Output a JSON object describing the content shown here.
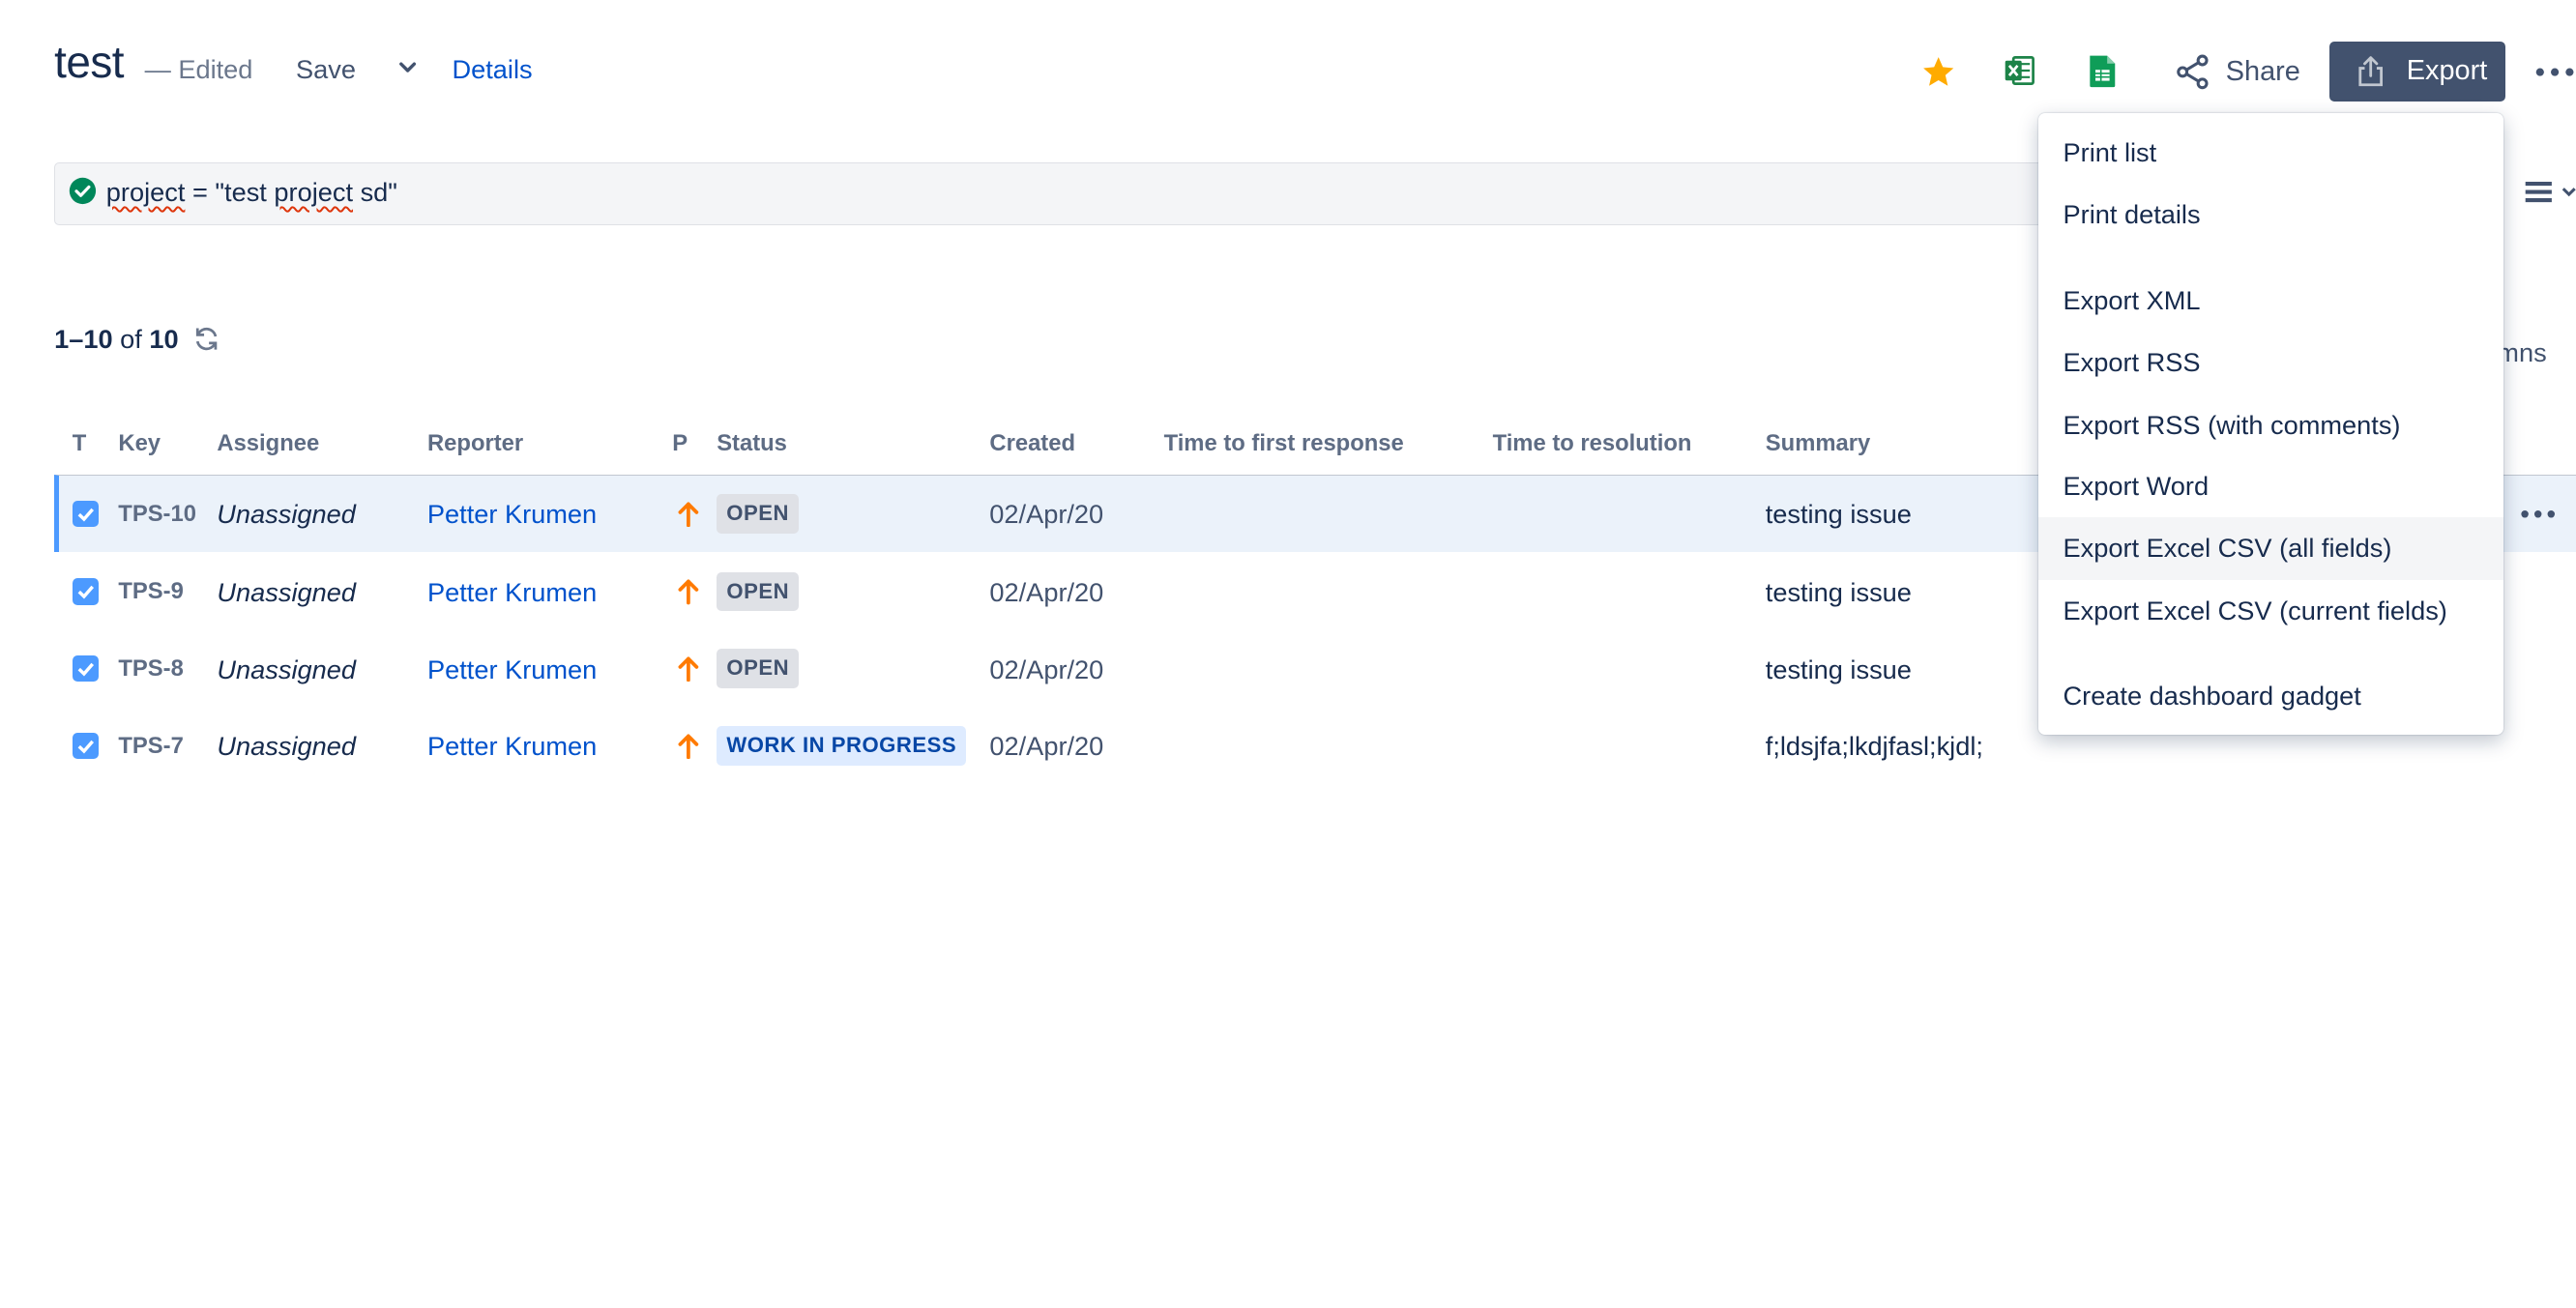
{
  "header": {
    "title": "test",
    "edited": "— Edited",
    "save_label": "Save",
    "details_label": "Details",
    "share_label": "Share",
    "export_label": "Export"
  },
  "query": {
    "text_prefix": "project",
    "text_mid": " = \"test ",
    "text_word": "project",
    "text_suffix": " sd\""
  },
  "pager": {
    "range": "1–10",
    "of": " of ",
    "total": "10"
  },
  "columns_partial": "mns",
  "table": {
    "headers": [
      "T",
      "Key",
      "Assignee",
      "Reporter",
      "P",
      "Status",
      "Created",
      "Time to first response",
      "Time to resolution",
      "Summary"
    ],
    "rows": [
      {
        "key": "TPS-10",
        "assignee": "Unassigned",
        "reporter": "Petter Krumen",
        "status": "OPEN",
        "created": "02/Apr/20",
        "summary": "testing issue"
      },
      {
        "key": "TPS-9",
        "assignee": "Unassigned",
        "reporter": "Petter Krumen",
        "status": "OPEN",
        "created": "02/Apr/20",
        "summary": "testing issue"
      },
      {
        "key": "TPS-8",
        "assignee": "Unassigned",
        "reporter": "Petter Krumen",
        "status": "OPEN",
        "created": "02/Apr/20",
        "summary": "testing issue"
      },
      {
        "key": "TPS-7",
        "assignee": "Unassigned",
        "reporter": "Petter Krumen",
        "status": "WORK IN PROGRESS",
        "created": "02/Apr/20",
        "summary": "f;ldsjfa;lkdjfasl;kjdl;"
      }
    ]
  },
  "export_menu": {
    "items": [
      "Print list",
      "Print details",
      "Export XML",
      "Export RSS",
      "Export RSS (with comments)",
      "Export Word",
      "Export Excel CSV (all fields)",
      "Export Excel CSV (current fields)",
      "Create dashboard gadget"
    ]
  },
  "colors": {
    "brand_blue": "#0052cc",
    "export_button": "#42526e",
    "star": "#ffab00",
    "excel_green": "#1d8348",
    "sheets_green": "#0f9d58",
    "priority_orange": "#ff7a00",
    "checkbox_blue": "#4c9aff",
    "ok_green": "#00875a"
  },
  "icons": {
    "star": "star-icon",
    "excel": "excel-icon",
    "sheets": "google-sheets-icon",
    "share": "share-icon",
    "export": "export-icon",
    "more": "more-icon",
    "query_ok": "check-circle-icon",
    "view": "list-view-icon",
    "refresh": "refresh-icon",
    "priority": "arrow-up-icon"
  }
}
